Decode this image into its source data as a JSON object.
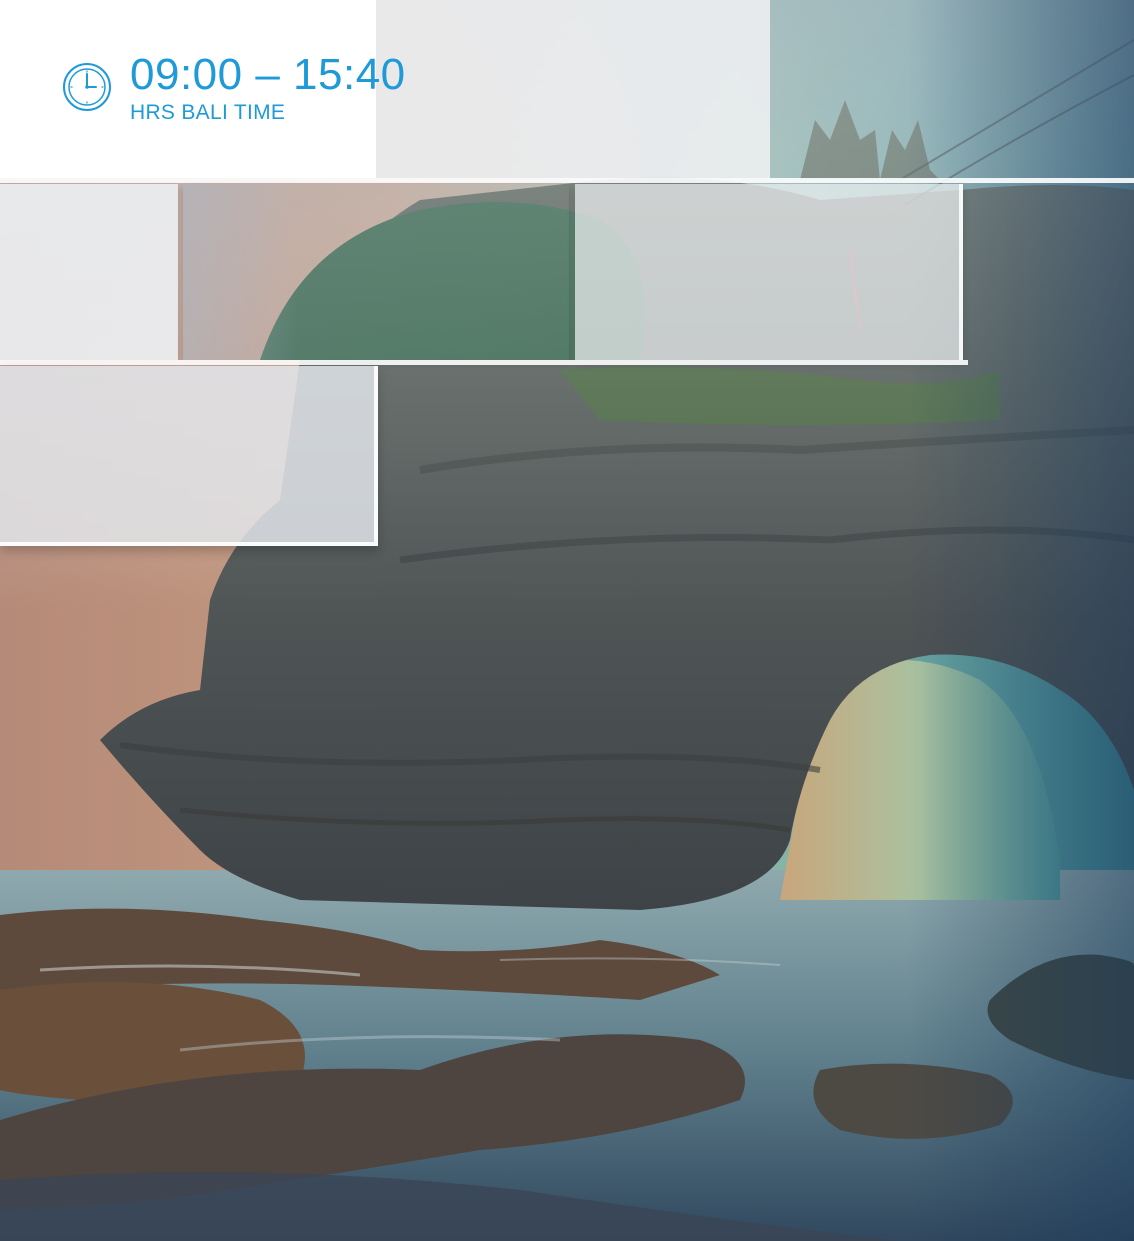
{
  "schedule": {
    "time_range": "09:00 – 15:40",
    "zone_label": "HRS BALI TIME"
  },
  "icon": "clock-icon",
  "colors": {
    "accent": "#1f9ad9",
    "panel": "#ffffff"
  }
}
